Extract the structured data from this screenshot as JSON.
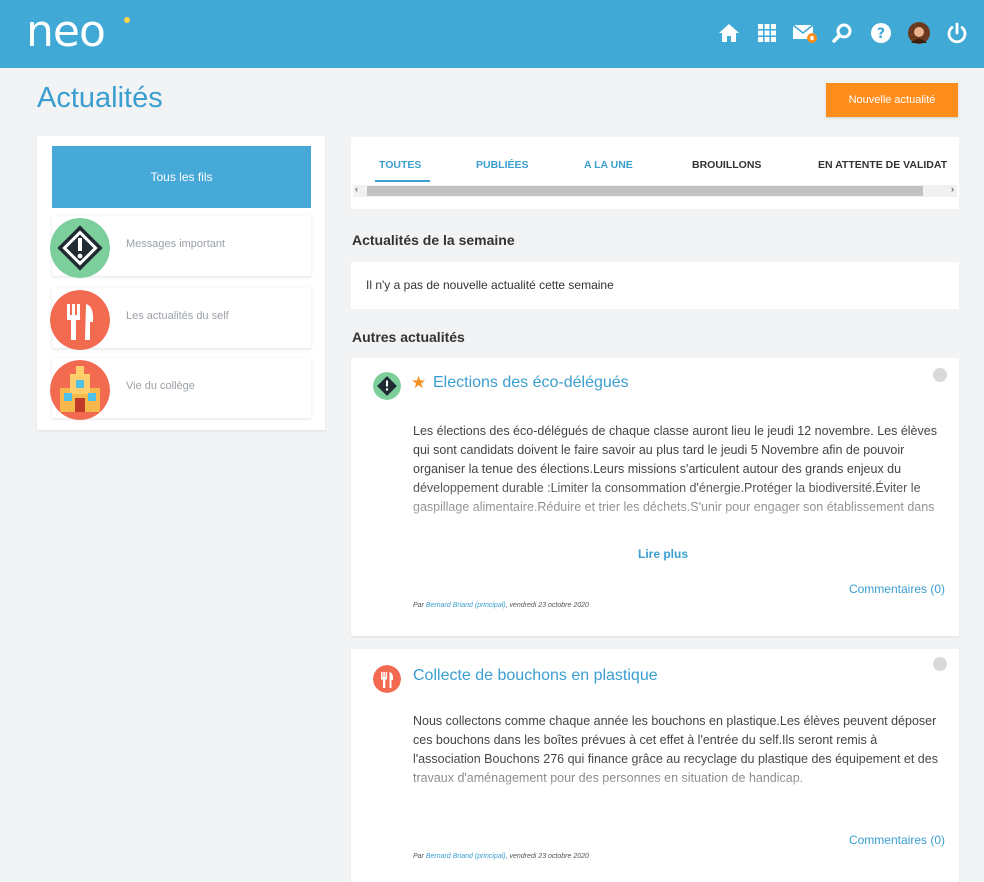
{
  "header": {
    "logo_text": "neo",
    "icons": [
      "home-icon",
      "apps-grid-icon",
      "messages-icon",
      "search-icon",
      "help-icon",
      "avatar",
      "power-icon"
    ]
  },
  "page": {
    "title": "Actualités",
    "new_button_label": "Nouvelle actualité"
  },
  "sidebar": {
    "active_label": "Tous les fils",
    "items": [
      {
        "label": "Messages important",
        "icon": "warning-diamond-icon"
      },
      {
        "label": "Les actualités du self",
        "icon": "fork-knife-icon"
      },
      {
        "label": "Vie du collège",
        "icon": "school-building-icon"
      }
    ]
  },
  "tabs": [
    {
      "label": "TOUTES",
      "active": true
    },
    {
      "label": "PUBLIÉES"
    },
    {
      "label": "A LA UNE"
    },
    {
      "label": "BROUILLONS"
    },
    {
      "label": "EN ATTENTE DE VALIDAT"
    }
  ],
  "week_section": {
    "title": "Actualités de la semaine",
    "empty_text": "Il n'y a pas de nouvelle actualité cette semaine"
  },
  "other_section": {
    "title": "Autres actualités"
  },
  "articles": [
    {
      "title": "Elections des éco-délégués",
      "starred": true,
      "body": "Les élections des  éco-délégués  de chaque classe auront lieu le jeudi 12 novembre. Les élèves qui sont candidats doivent le faire savoir au plus tard le jeudi 5 Novembre afin de pouvoir organiser la tenue des élections.Leurs missions s'articulent autour des grands enjeux du développement durable :Limiter la consommation d'énergie.Protéger la biodiversité.Éviter le gaspillage alimentaire.Réduire et trier les déchets.S'unir pour engager son établissement dans",
      "read_more": "Lire plus",
      "comments": "Commentaires (0)",
      "byline_prefix": "Par ",
      "author": "Bernard Briand (principal)",
      "date": ", vendredi 23 octobre 2020"
    },
    {
      "title": "Collecte de bouchons en plastique",
      "starred": false,
      "body": "Nous collectons comme chaque année les bouchons en plastique.Les élèves peuvent déposer ces bouchons dans les boîtes prévues à cet effet à l'entrée du self.Ils seront remis à l'association Bouchons 276 qui finance grâce au recyclage du plastique des équipement et des travaux d'aménagement pour des personnes en situation de handicap.",
      "comments": "Commentaires (0)",
      "byline_prefix": "Par ",
      "author": "Bernard Briand (principal)",
      "date": ", vendredi 23 octobre 2020"
    }
  ]
}
